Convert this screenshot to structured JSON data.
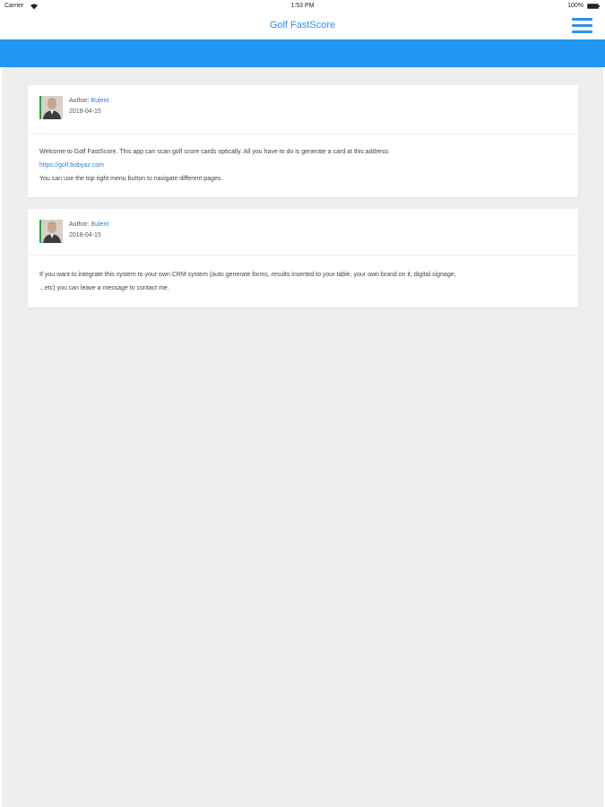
{
  "status_bar": {
    "carrier": "Carrier",
    "time": "1:53 PM",
    "battery": "100%"
  },
  "nav": {
    "title": "Golf FastScore"
  },
  "colors": {
    "accent": "#2f8ff0",
    "banner": "#2196f3",
    "background": "#eeeeee",
    "link": "#2f7fd6"
  },
  "posts": [
    {
      "author_label": "Author:",
      "author_name": "Bulent",
      "date": "2018-04-15",
      "line1": "Welcome to Golf FastScore. This app can scan golf score cards optically. All you have to do is generate a card at this address:",
      "link": "https://golf.bobyaz.com",
      "line3": "You can use the top right menu button to navigate different pages."
    },
    {
      "author_label": "Author:",
      "author_name": "Bulent",
      "date": "2018-04-15",
      "line1": "If you want to integrate this system to your own CRM system (auto generate forms, results inserted to your table, your own brand on it, digital signage,",
      "line2": "...etc) you can leave a message to contact me."
    }
  ]
}
